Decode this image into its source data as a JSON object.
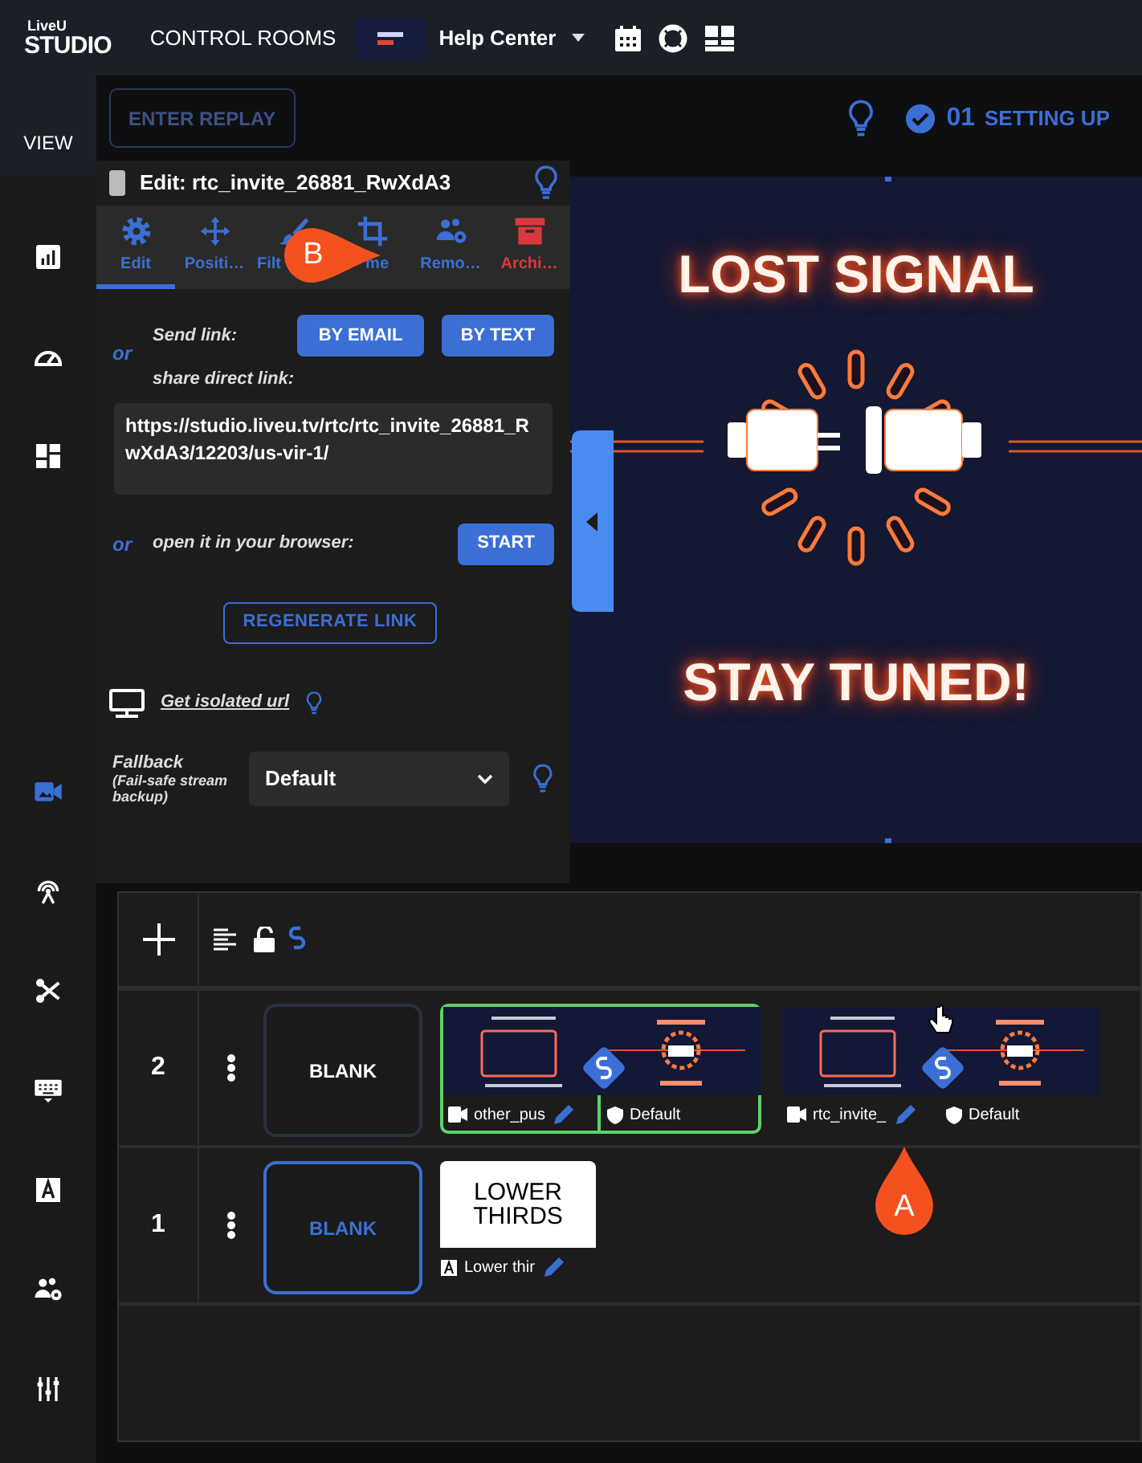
{
  "top_bar": {
    "logo_small": "LiveU",
    "logo": "STUDIO",
    "nav_link": "CONTROL ROOMS",
    "room": "Help Center"
  },
  "sidebar": {
    "heading": "VIEW",
    "items": [
      {
        "kind": "chart",
        "selected": false
      },
      {
        "kind": "gauge",
        "selected": false
      },
      {
        "kind": "dashboard",
        "selected": false
      },
      {
        "kind": "camera",
        "selected": true
      },
      {
        "kind": "broadcast",
        "selected": false
      },
      {
        "kind": "scissors",
        "selected": false
      },
      {
        "kind": "keyboard",
        "selected": false
      },
      {
        "kind": "text",
        "selected": false
      },
      {
        "kind": "users",
        "selected": false
      },
      {
        "kind": "sliders",
        "selected": false
      }
    ]
  },
  "toolbar": {
    "replay_button": {
      "label": "ENTER REPLAY",
      "disabled": true
    },
    "step_number": "01",
    "step_label": "SETTING UP"
  },
  "editor": {
    "title": "Edit: rtc_invite_26881_RwXdA3",
    "tabs": [
      {
        "kind": "gear",
        "label": "Edit",
        "selected": true
      },
      {
        "kind": "move",
        "label": "Positi…",
        "selected": false
      },
      {
        "kind": "brush",
        "label": "Filt",
        "selected": false
      },
      {
        "kind": "frame",
        "label": "me",
        "selected": false
      },
      {
        "kind": "users",
        "label": "Remo…",
        "selected": false
      },
      {
        "kind": "archive",
        "label": "Archi…",
        "selected": false
      }
    ],
    "send_or": "or",
    "send_label": "Send link:",
    "email_button": "BY EMAIL",
    "text_button": "BY TEXT",
    "share_label": "share direct link:",
    "link": "https://studio.liveu.tv/rtc/rtc_invite_26881_RwXdA3/12203/us-vir-1/",
    "open_or": "or",
    "open_label": "open it in your browser:",
    "start_button": "START",
    "regenerate_button": "REGENERATE LINK",
    "isolated_link": "Get isolated url",
    "fallback_label": "Fallback",
    "fallback_hint": "(Fail-safe stream backup)",
    "fallback_value": "Default"
  },
  "preview": {
    "headline": "LOST SIGNAL",
    "tagline": "STAY TUNED!"
  },
  "layers": {
    "rows": [
      {
        "number": "2",
        "blank": {
          "label": "BLANK",
          "selected": false
        },
        "sources": [
          {
            "kind": "linked",
            "on_air": true,
            "name": "other_pus",
            "fallback": "Default"
          },
          {
            "kind": "linked",
            "on_air": false,
            "name": "rtc_invite_",
            "fallback": "Default"
          }
        ]
      },
      {
        "number": "1",
        "blank": {
          "label": "BLANK",
          "selected": true
        },
        "sources": [
          {
            "kind": "graphic",
            "title": "LOWER THIRDS",
            "name": "Lower thir"
          }
        ]
      }
    ]
  },
  "markers": [
    {
      "label": "B"
    },
    {
      "label": "A"
    }
  ]
}
